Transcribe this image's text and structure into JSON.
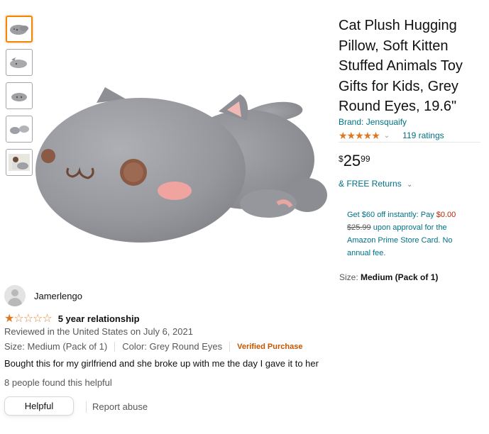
{
  "thumbnails": [
    {
      "icon": "cat-plush-thumb-icon",
      "selected": true
    },
    {
      "icon": "cat-plush-thumb-icon",
      "selected": false
    },
    {
      "icon": "cat-plush-thumb-icon",
      "selected": false
    },
    {
      "icon": "cat-plush-thumb-icon",
      "selected": false
    },
    {
      "icon": "person-with-plush-thumb-icon",
      "selected": false
    }
  ],
  "product": {
    "title": "Cat Plush Hugging Pillow, Soft Kitten Stuffed Animals Toy Gifts for Kids, Grey Round Eyes, 19.6\"",
    "brand": "Brand: Jensquaify",
    "stars": "★★★★★",
    "ratings": "119 ratings",
    "price_symbol": "$",
    "price_whole": "25",
    "price_fraction": "99",
    "returns": "& FREE Returns",
    "promo": {
      "pre": "Get $60 off instantly: Pay ",
      "new_price": "$0.00",
      "old_price": "$25.99",
      "post": " upon approval for the Amazon Prime Store Card. No annual fee."
    },
    "size_label": "Size: ",
    "size_value": "Medium (Pack of 1)"
  },
  "review": {
    "reviewer": "Jamerlengo",
    "rating": 1,
    "title": "5 year relationship",
    "meta": "Reviewed in the United States on July 6, 2021",
    "size": "Size: Medium (Pack of 1)",
    "color": "Color: Grey Round Eyes",
    "verified": "Verified Purchase",
    "body": "Bought this for my girlfriend and she broke up with me the day I gave it to her",
    "helpful_count": "8 people found this helpful",
    "helpful_button": "Helpful",
    "report": "Report abuse"
  },
  "colors": {
    "star": "#de7921",
    "link": "#007185",
    "price_red": "#b12704",
    "verified": "#c45500",
    "thumb_selected": "#f08804"
  }
}
